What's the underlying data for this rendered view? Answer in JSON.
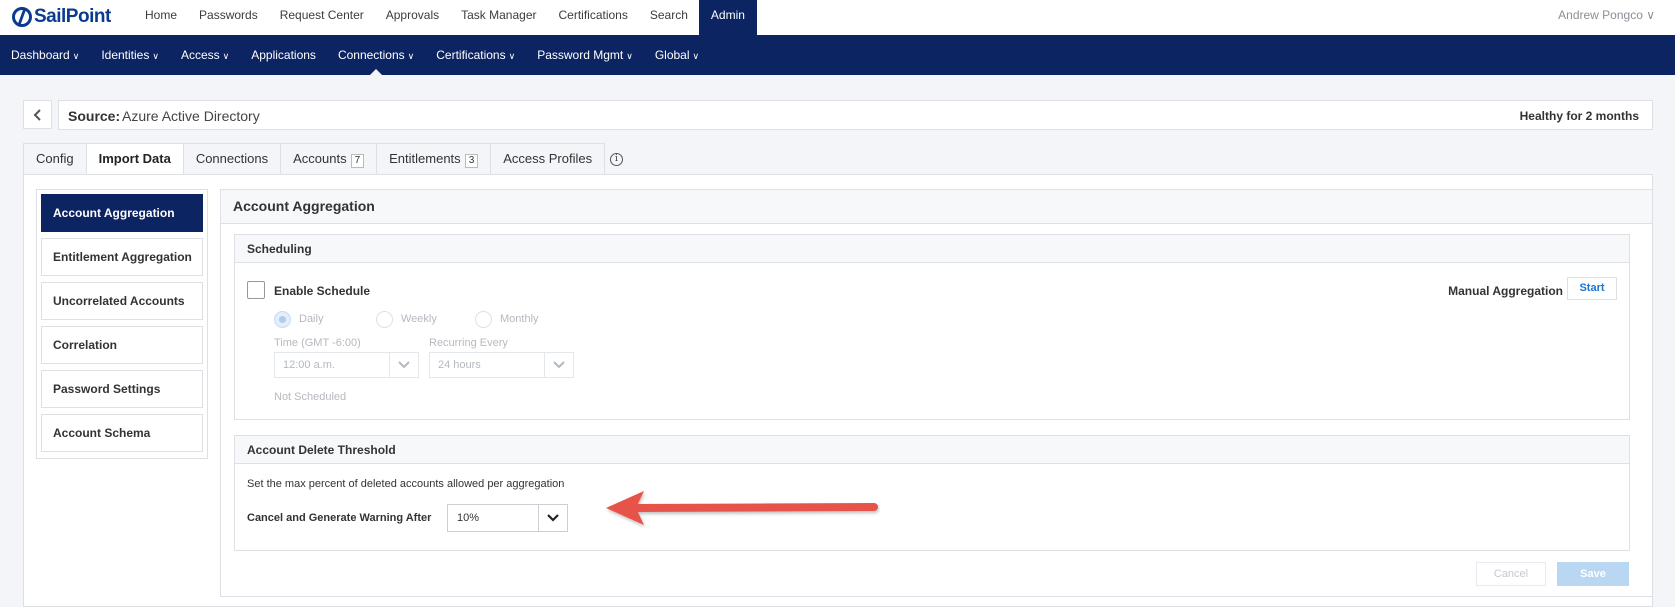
{
  "brand": {
    "logo_text": "SailPoint"
  },
  "topnav": {
    "items": [
      {
        "label": "Home"
      },
      {
        "label": "Passwords"
      },
      {
        "label": "Request Center"
      },
      {
        "label": "Approvals"
      },
      {
        "label": "Task Manager"
      },
      {
        "label": "Certifications"
      },
      {
        "label": "Search"
      },
      {
        "label": "Admin",
        "active": true
      }
    ],
    "user": "Andrew Pongco ∨"
  },
  "subnav": {
    "items": [
      {
        "label": "Dashboard",
        "chevron": "∨"
      },
      {
        "label": "Identities",
        "chevron": "∨"
      },
      {
        "label": "Access",
        "chevron": "∨"
      },
      {
        "label": "Applications",
        "chevron": ""
      },
      {
        "label": "Connections",
        "chevron": "∨",
        "active": true
      },
      {
        "label": "Certifications",
        "chevron": "∨"
      },
      {
        "label": "Password Mgmt",
        "chevron": "∨"
      },
      {
        "label": "Global",
        "chevron": "∨"
      }
    ]
  },
  "source": {
    "label": "Source:",
    "name": "Azure Active Directory",
    "health": "Healthy for 2 months"
  },
  "tabs": [
    {
      "label": "Config"
    },
    {
      "label": "Import Data",
      "active": true
    },
    {
      "label": "Connections"
    },
    {
      "label": "Accounts",
      "badge": "7"
    },
    {
      "label": "Entitlements",
      "badge": "3"
    },
    {
      "label": "Access Profiles"
    }
  ],
  "info_icon": "info-icon",
  "side_menu": [
    {
      "label": "Account Aggregation",
      "active": true
    },
    {
      "label": "Entitlement Aggregation"
    },
    {
      "label": "Uncorrelated Accounts"
    },
    {
      "label": "Correlation"
    },
    {
      "label": "Password Settings"
    },
    {
      "label": "Account Schema"
    }
  ],
  "content": {
    "title": "Account Aggregation",
    "scheduling": {
      "header": "Scheduling",
      "enable_label": "Enable Schedule",
      "enabled": false,
      "frequency_options": [
        "Daily",
        "Weekly",
        "Monthly"
      ],
      "frequency_selected": "Daily",
      "time_label": "Time (GMT -6:00)",
      "time_value": "12:00 a.m.",
      "recurring_label": "Recurring Every",
      "recurring_value": "24 hours",
      "status": "Not Scheduled",
      "manual_label": "Manual Aggregation",
      "start_label": "Start"
    },
    "delete_threshold": {
      "header": "Account Delete Threshold",
      "description": "Set the max percent of deleted accounts allowed per aggregation",
      "warning_label": "Cancel and Generate Warning After",
      "value": "10%"
    },
    "actions": {
      "cancel": "Cancel",
      "save": "Save"
    }
  },
  "colors": {
    "nav_dark": "#0c2461",
    "accent_blue": "#1b75d0",
    "annotation_arrow": "#e8534a",
    "save_disabled": "#b9d6f2"
  }
}
